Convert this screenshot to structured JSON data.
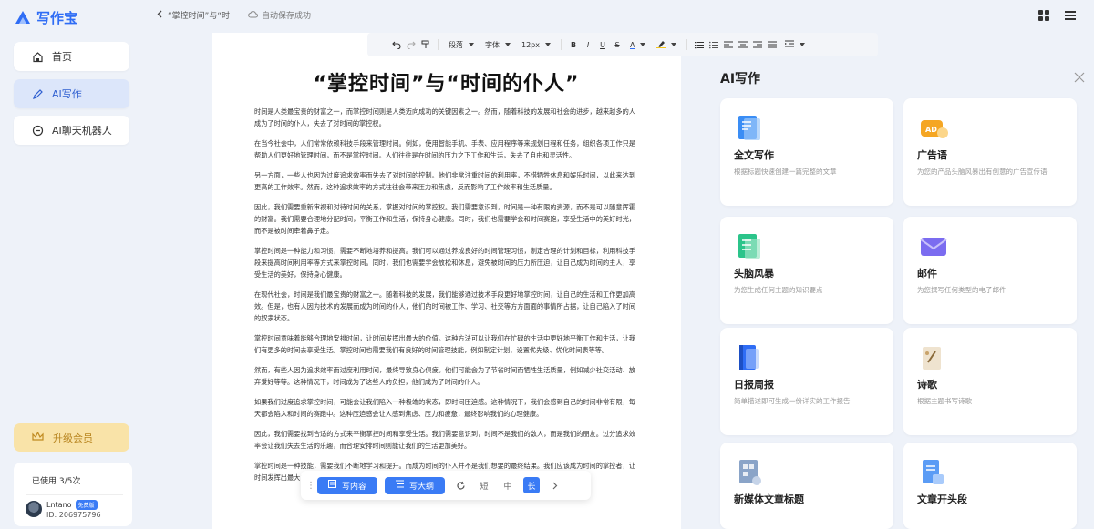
{
  "app": {
    "name": "写作宝"
  },
  "sidebar": {
    "items": [
      {
        "label": "首页",
        "icon": "home-icon"
      },
      {
        "label": "AI写作",
        "icon": "pen-icon"
      },
      {
        "label": "AI聊天机器人",
        "icon": "chat-icon"
      }
    ],
    "upgrade_label": "升级会员",
    "usage_text": "已使用 3/5次",
    "user": {
      "name": "Lntano",
      "badge": "免费版",
      "id": "ID: 206975796"
    }
  },
  "topbar": {
    "back_title": "“掌控时间”与“时",
    "save_status": "自动保存成功"
  },
  "toolbar": {
    "paragraph": "段落",
    "font": "字体",
    "size": "12px",
    "bold": "B",
    "italic": "I",
    "underline": "U",
    "strike": "S",
    "font_color": "A"
  },
  "document": {
    "title": "“掌控时间”与“时间的仆人”",
    "paragraphs": [
      "时间是人类最宝贵的财富之一，而掌控时间则是人类迈向成功的关键因素之一。然而，随着科技的发展和社会的进步，越来越多的人成为了时间的仆人，失去了对时间的掌控权。",
      "在当今社会中，人们常常依赖科技手段来管理时间。例如，使用智能手机、手表、应用程序等来规划日程和任务，组织各项工作只是帮助人们更好地管理时间，而不是掌控时间。人们往往是在时间的压力之下工作和生活，失去了自由和灵活性。",
      "另一方面，一些人也因为过度追求效率而失去了对时间的控制。他们非常注重时间的利用率，不惜牺牲休息和娱乐时间，以此来达到更高的工作效率。然而，这种追求效率的方式往往会带来压力和焦虑，反而影响了工作效率和生活质量。",
      "因此，我们需要重新审视和对待时间的关系，掌握对时间的掌控权。我们需要意识到，时间是一种有限的资源，而不是可以随意挥霍的财富。我们需要合理地分配时间，平衡工作和生活，保持身心健康。同时，我们也需要学会和时间赛跑，享受生活中的美好时光，而不是被时间牵着鼻子走。",
      "掌控时间是一种能力和习惯，需要不断地培养和提高。我们可以通过养成良好的时间管理习惯，制定合理的计划和目标，利用科技手段来提高时间利用率等方式来掌控时间。同时，我们也需要学会放松和休息，避免被时间的压力所压迫，让自己成为时间的主人，享受生活的美好，保持身心健康。",
      "在现代社会，时间是我们最宝贵的财富之一。随着科技的发展，我们能够通过技术手段更好地掌控时间，让自己的生活和工作更加高效。但是，也有人因为技术的发展而成为时间的仆人，他们的时间被工作、学习、社交等方方面面的事情所占据，让自己陷入了时间的奴隶状态。",
      "掌控时间意味着能够合理地安排时间，让时间发挥出最大的价值。这种方法可以让我们在忙碌的生活中更好地平衡工作和生活，让我们有更多的时间去享受生活。掌控时间也需要我们有良好的时间管理技能，例如制定计划、设置优先级、优化时间表等等。",
      "然而，有些人因为追求效率而过度利用时间，最终导致身心俱疲。他们可能会为了节省时间而牺牲生活质量，例如减少社交活动、放弃爱好等等。这种情况下，时间成为了这些人的负担，他们成为了时间的仆人。",
      "如果我们过度追求掌控时间，可能会让我们陷入一种极端的状态，即时间压迫感。这种情况下，我们会感到自己的时间非常有限，每天都会陷入和时间的赛跑中。这种压迫感会让人感到焦虑、压力和疲惫，最终影响我们的心理健康。",
      "因此，我们需要找到合适的方式来平衡掌控时间和享受生活。我们需要意识到，时间不是我们的敌人，而是我们的朋友。过分追求效率会让我们失去生活的乐趣，而合理安排时间则能让我们的生活更加美好。",
      "掌控时间是一种技能，需要我们不断地学习和提升。而成为时间的仆人并不是我们想要的最终结果。我们应该成为时间的掌控者，让时间发挥出最大的价值，让我们的生活和工作更加高效和愉悦。"
    ]
  },
  "bottom_bar": {
    "write_content": "写内容",
    "write_outline": "写大纲",
    "short": "短",
    "medium": "中",
    "long": "长"
  },
  "ai_panel": {
    "title": "AI写作",
    "cards": [
      {
        "title": "全文写作",
        "desc": "根据标题快速创建一篇完整的文章",
        "icon": "document-icon",
        "color": "#3a8df5"
      },
      {
        "title": "广告语",
        "desc": "为您的产品头脑风暴出有创意的广告宣传语",
        "icon": "ad-icon",
        "color": "#f5a623"
      },
      {
        "title": "头脑风暴",
        "desc": "为您生成任何主题的知识要点",
        "icon": "list-icon",
        "color": "#2bc48a"
      },
      {
        "title": "邮件",
        "desc": "为您撰写任何类型的电子邮件",
        "icon": "mail-icon",
        "color": "#7b6cf0"
      },
      {
        "title": "日报周报",
        "desc": "简单描述即可生成一份详实的工作报告",
        "icon": "report-icon",
        "color": "#2f6df5"
      },
      {
        "title": "诗歌",
        "desc": "根据主题书写诗歌",
        "icon": "poem-icon",
        "color": "#c9a36b"
      },
      {
        "title": "新媒体文章标题",
        "desc": "",
        "icon": "media-icon",
        "color": "#8aa4c8"
      },
      {
        "title": "文章开头段",
        "desc": "",
        "icon": "opening-icon",
        "color": "#5b9cf5"
      }
    ]
  }
}
